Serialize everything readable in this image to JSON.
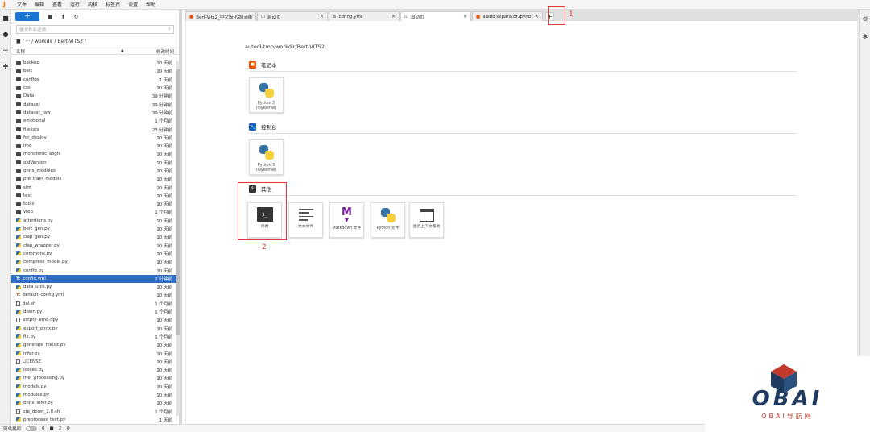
{
  "menubar": {
    "items": [
      "文件",
      "编辑",
      "查看",
      "运行",
      "内核",
      "标签页",
      "设置",
      "帮助"
    ]
  },
  "filebrowser": {
    "search_placeholder": "搜文件名过滤",
    "breadcrumb": "■ / ··· / workdir / Bert-VITS2 /",
    "col_name": "名称",
    "col_modified": "修改时间",
    "items": [
      {
        "name": "backup",
        "type": "folder",
        "time": "10 天前"
      },
      {
        "name": "bert",
        "type": "folder",
        "time": "10 天前"
      },
      {
        "name": "configs",
        "type": "folder",
        "time": "1 天前"
      },
      {
        "name": "css",
        "type": "folder",
        "time": "10 天前"
      },
      {
        "name": "Data",
        "type": "folder",
        "time": "39 分钟前"
      },
      {
        "name": "dataset",
        "type": "folder",
        "time": "39 分钟前"
      },
      {
        "name": "dataset_raw",
        "type": "folder",
        "time": "39 分钟前"
      },
      {
        "name": "emotional",
        "type": "folder",
        "time": "1 个月前"
      },
      {
        "name": "filelists",
        "type": "folder",
        "time": "23 分钟前"
      },
      {
        "name": "for_deploy",
        "type": "folder",
        "time": "10 天前"
      },
      {
        "name": "img",
        "type": "folder",
        "time": "10 天前"
      },
      {
        "name": "monotonic_align",
        "type": "folder",
        "time": "10 天前"
      },
      {
        "name": "oldVersion",
        "type": "folder",
        "time": "10 天前"
      },
      {
        "name": "onnx_modules",
        "type": "folder",
        "time": "10 天前"
      },
      {
        "name": "pre_train_models",
        "type": "folder",
        "time": "10 天前"
      },
      {
        "name": "slm",
        "type": "folder",
        "time": "20 天前"
      },
      {
        "name": "text",
        "type": "folder",
        "time": "10 天前"
      },
      {
        "name": "tools",
        "type": "folder",
        "time": "10 天前"
      },
      {
        "name": "Web",
        "type": "folder",
        "time": "1 个月前"
      },
      {
        "name": "attentions.py",
        "type": "py",
        "time": "10 天前"
      },
      {
        "name": "bert_gen.py",
        "type": "py",
        "time": "10 天前"
      },
      {
        "name": "clap_gen.py",
        "type": "py",
        "time": "10 天前"
      },
      {
        "name": "clap_wrapper.py",
        "type": "py",
        "time": "10 天前"
      },
      {
        "name": "commons.py",
        "type": "py",
        "time": "10 天前"
      },
      {
        "name": "compress_model.py",
        "type": "py",
        "time": "10 天前"
      },
      {
        "name": "config.py",
        "type": "py",
        "time": "10 天前"
      },
      {
        "name": "config.yml",
        "type": "yml",
        "time": "2 分钟前",
        "selected": true
      },
      {
        "name": "data_utils.py",
        "type": "py",
        "time": "10 天前"
      },
      {
        "name": "default_config.yml",
        "type": "yml",
        "time": "10 天前"
      },
      {
        "name": "dal.sh",
        "type": "file",
        "time": "1 个月前"
      },
      {
        "name": "down.py",
        "type": "py",
        "time": "1 个月前"
      },
      {
        "name": "empty_emo.npy",
        "type": "file",
        "time": "10 天前"
      },
      {
        "name": "export_onnx.py",
        "type": "py",
        "time": "10 天前"
      },
      {
        "name": "fix.py",
        "type": "py",
        "time": "1 个月前"
      },
      {
        "name": "generate_filelist.py",
        "type": "py",
        "time": "10 天前"
      },
      {
        "name": "infer.py",
        "type": "py",
        "time": "10 天前"
      },
      {
        "name": "LICENSE",
        "type": "file",
        "time": "10 天前"
      },
      {
        "name": "losses.py",
        "type": "py",
        "time": "10 天前"
      },
      {
        "name": "mel_processing.py",
        "type": "py",
        "time": "10 天前"
      },
      {
        "name": "models.py",
        "type": "py",
        "time": "10 天前"
      },
      {
        "name": "modules.py",
        "type": "py",
        "time": "10 天前"
      },
      {
        "name": "onnx_infer.py",
        "type": "py",
        "time": "10 天前"
      },
      {
        "name": "pre_down_2.0.sh",
        "type": "file",
        "time": "1 个月前"
      },
      {
        "name": "preprocess_text.py",
        "type": "py",
        "time": "1 天前"
      }
    ]
  },
  "tabs": [
    {
      "label": "Bert-Vits2_中文简化版(清晰)(●",
      "icon": "notebook-icon",
      "active": false
    },
    {
      "label": "启动页",
      "icon": "launcher-icon",
      "active": false
    },
    {
      "label": "config.yml",
      "icon": "file-icon",
      "active": false
    },
    {
      "label": "启动页",
      "icon": "launcher-icon",
      "active": true
    },
    {
      "label": "audio separator.ipynb",
      "icon": "notebook-icon",
      "active": false
    }
  ],
  "annotations": {
    "label1": "1",
    "label2": "2"
  },
  "launcher": {
    "path": "autodl-tmp/workdir/Bert-VITS2",
    "sections": {
      "notebook": {
        "title": "笔记本",
        "card_label": "Python 3 (ipykernel)"
      },
      "console": {
        "title": "控制台",
        "card_label": "Python 3 (ipykernel)"
      },
      "other": {
        "title": "其他",
        "cards": [
          "终端",
          "文本文件",
          "Markdown 文件",
          "Python 文件",
          "显示上下文帮助"
        ]
      }
    }
  },
  "statusbar": {
    "mode_label": "简单界面",
    "count1": "0",
    "count2": "2"
  },
  "watermark": {
    "title": "OBAI",
    "subtitle": "OBAI导航网"
  },
  "colors": {
    "accent": "#1976d2",
    "selected": "#2d6cc0",
    "annotation": "#e53935"
  }
}
